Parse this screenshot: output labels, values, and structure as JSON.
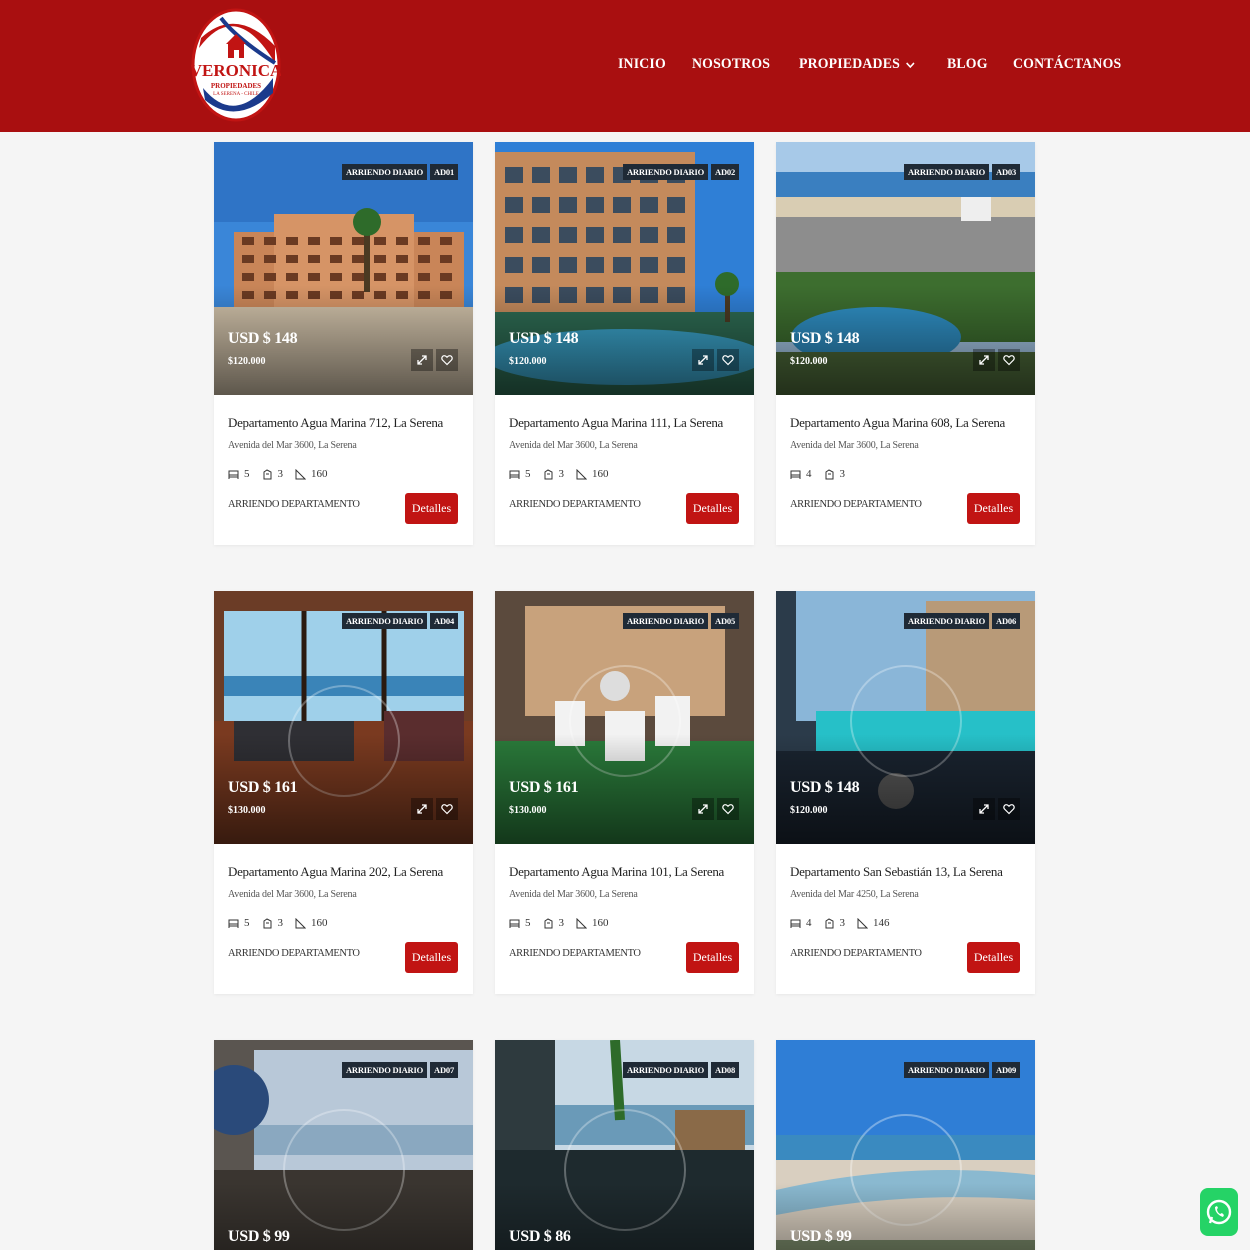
{
  "brand": {
    "name": "VERONICA",
    "sub": "PROPIEDADES",
    "sub2": "LA SERENA - CHILE"
  },
  "nav": [
    {
      "label": "INICIO"
    },
    {
      "label": "NOSOTROS"
    },
    {
      "label": "PROPIEDADES",
      "dropdown": true
    },
    {
      "label": "BLOG"
    },
    {
      "label": "CONTÁCTANOS"
    }
  ],
  "colors": {
    "brand_red": "#a90f10",
    "button_red": "#c11413",
    "badge_dark": "#1f2a36",
    "whatsapp_green": "#25d366"
  },
  "listings": [
    {
      "badge": "ARRIENDO DIARIO",
      "code": "AD01",
      "price": "USD $ 148",
      "price_clp": "$120.000",
      "title": "Departamento Agua Marina 712, La Serena",
      "address": "Avenida del Mar 3600, La Serena",
      "beds": "5",
      "baths": "3",
      "area": "160",
      "type": "ARRIENDO DEPARTAMENTO",
      "cta": "Detalles"
    },
    {
      "badge": "ARRIENDO DIARIO",
      "code": "AD02",
      "price": "USD $ 148",
      "price_clp": "$120.000",
      "title": "Departamento Agua Marina 111, La Serena",
      "address": "Avenida del Mar 3600, La Serena",
      "beds": "5",
      "baths": "3",
      "area": "160",
      "type": "ARRIENDO DEPARTAMENTO",
      "cta": "Detalles"
    },
    {
      "badge": "ARRIENDO DIARIO",
      "code": "AD03",
      "price": "USD $ 148",
      "price_clp": "$120.000",
      "title": "Departamento Agua Marina 608, La Serena",
      "address": "Avenida del Mar 3600, La Serena",
      "beds": "4",
      "baths": "3",
      "area": "",
      "type": "ARRIENDO DEPARTAMENTO",
      "cta": "Detalles"
    },
    {
      "badge": "ARRIENDO DIARIO",
      "code": "AD04",
      "price": "USD $ 161",
      "price_clp": "$130.000",
      "title": "Departamento Agua Marina 202, La Serena",
      "address": "Avenida del Mar 3600, La Serena",
      "beds": "5",
      "baths": "3",
      "area": "160",
      "type": "ARRIENDO DEPARTAMENTO",
      "cta": "Detalles"
    },
    {
      "badge": "ARRIENDO DIARIO",
      "code": "AD05",
      "price": "USD $ 161",
      "price_clp": "$130.000",
      "title": "Departamento Agua Marina 101, La Serena",
      "address": "Avenida del Mar 3600, La Serena",
      "beds": "5",
      "baths": "3",
      "area": "160",
      "type": "ARRIENDO DEPARTAMENTO",
      "cta": "Detalles"
    },
    {
      "badge": "ARRIENDO DIARIO",
      "code": "AD06",
      "price": "USD $ 148",
      "price_clp": "$120.000",
      "title": "Departamento San Sebastián 13, La Serena",
      "address": "Avenida del Mar 4250, La Serena",
      "beds": "4",
      "baths": "3",
      "area": "146",
      "type": "ARRIENDO DEPARTAMENTO",
      "cta": "Detalles"
    },
    {
      "badge": "ARRIENDO DIARIO",
      "code": "AD07",
      "price": "USD $ 99",
      "price_clp": "",
      "title": "",
      "address": "",
      "beds": "",
      "baths": "",
      "area": "",
      "type": "",
      "cta": ""
    },
    {
      "badge": "ARRIENDO DIARIO",
      "code": "AD08",
      "price": "USD $ 86",
      "price_clp": "",
      "title": "",
      "address": "",
      "beds": "",
      "baths": "",
      "area": "",
      "type": "",
      "cta": ""
    },
    {
      "badge": "ARRIENDO DIARIO",
      "code": "AD09",
      "price": "USD $ 99",
      "price_clp": "",
      "title": "",
      "address": "",
      "beds": "",
      "baths": "",
      "area": "",
      "type": "",
      "cta": ""
    }
  ]
}
